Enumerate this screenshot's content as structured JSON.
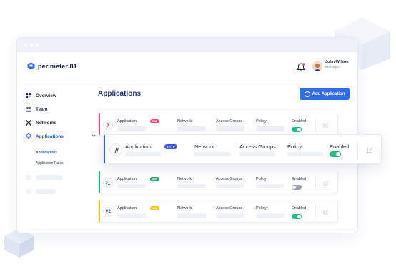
{
  "app": {
    "brand": "perimeter 81",
    "colors": {
      "accent": "#2f6ce5",
      "brand_dark": "#1f3c7a",
      "toggle_on": "#22c080",
      "toggle_off": "#9aa3b5"
    }
  },
  "header": {
    "user_name": "John Wilson",
    "user_role": "Manager",
    "icons": [
      "bell-icon",
      "avatar"
    ]
  },
  "sidebar": {
    "items": [
      {
        "label": "Overview",
        "icon": "grid-icon"
      },
      {
        "label": "Team",
        "icon": "users-icon"
      },
      {
        "label": "Networks",
        "icon": "network-icon"
      },
      {
        "label": "Applications",
        "icon": "layers-icon"
      }
    ],
    "sub_items": [
      {
        "label": "Applications"
      },
      {
        "label": "Application Rules"
      }
    ]
  },
  "main": {
    "title": "Applications",
    "add_button": "Add Application",
    "cards": [
      {
        "application_label": "Application",
        "badge": "RDP",
        "badge_color": "#f0506e",
        "network_label": "Network",
        "access_groups_label": "Access Groups",
        "policy_label": "Policy",
        "enabled_label": "Enabled",
        "enabled": true,
        "accent": "#f0506e",
        "icon": "rdp-icon"
      },
      {
        "application_label": "Application",
        "badge": "HTTP",
        "badge_color": "#3d5bd9",
        "network_label": "Network",
        "access_groups_label": "Access Groups",
        "policy_label": "Policy",
        "enabled_label": "Enabled",
        "enabled": true,
        "accent": "#3d5bd9",
        "icon": "http-icon"
      },
      {
        "application_label": "Application",
        "badge": "SSH",
        "badge_color": "#1fae6b",
        "network_label": "Network",
        "access_groups_label": "Access Groups",
        "policy_label": "Policy",
        "enabled_label": "Enabled",
        "enabled": false,
        "accent": "#1fae6b",
        "icon": "terminal-icon"
      },
      {
        "application_label": "Application",
        "badge": "VNC",
        "badge_color": "#f5c518",
        "network_label": "Network",
        "access_groups_label": "Access Groups",
        "policy_label": "Policy",
        "enabled_label": "Enabled",
        "enabled": true,
        "accent": "#f5c518",
        "icon": "vnc-icon"
      }
    ]
  }
}
